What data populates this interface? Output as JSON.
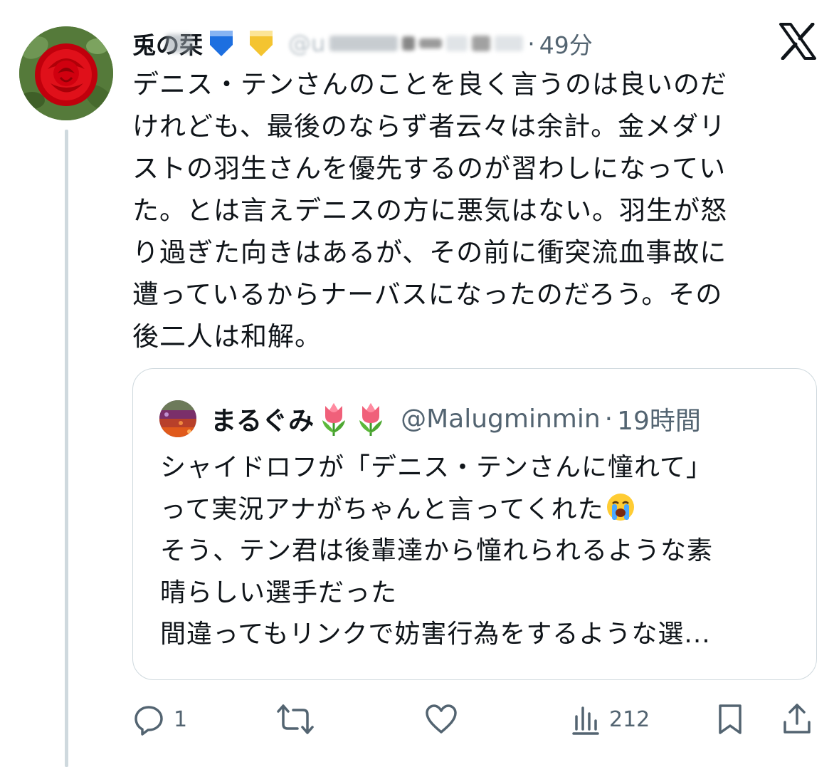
{
  "author": {
    "display_name": "兎の栞",
    "time": "49分"
  },
  "post": {
    "lines": [
      "デニス・テンさんのことを良く言うのは良いのだ",
      "けれども、最後のならず者云々は余計。金メダリ",
      "ストの羽生さんを優先するのが習わしになってい",
      "た。とは言えデニスの方に悪気はない。羽生が怒",
      "り過ぎた向きはあるが、その前に衝突流血事故に",
      "遭っているからナーバスになったのだろう。その",
      "後二人は和解。"
    ]
  },
  "quote": {
    "display_name": "まるぐみ",
    "handle": "@Malugminmin",
    "separator": "·",
    "time": "19時間",
    "lines": [
      "シャイドロフが「デニス・テンさんに憧れて」",
      "って実況アナがちゃんと言ってくれた",
      "そう、テン君は後輩達から憧れられるような素",
      "晴らしい選手だった",
      "間違ってもリンクで妨害行為をするような選..."
    ],
    "emoji": "loudly-crying-face"
  },
  "actions": {
    "replies": "1",
    "views": "212"
  },
  "icons": {
    "reply": "reply-icon",
    "retweet": "retweet-icon",
    "like": "like-icon",
    "views": "views-icon",
    "bookmark": "bookmark-icon",
    "share": "share-icon",
    "x_logo": "x-logo-icon"
  },
  "colors": {
    "text": "#0f1419",
    "secondary": "#536471",
    "border": "#cfd9de",
    "blue_badge": "#1d9bf0",
    "gold_badge": "#f4c430"
  }
}
